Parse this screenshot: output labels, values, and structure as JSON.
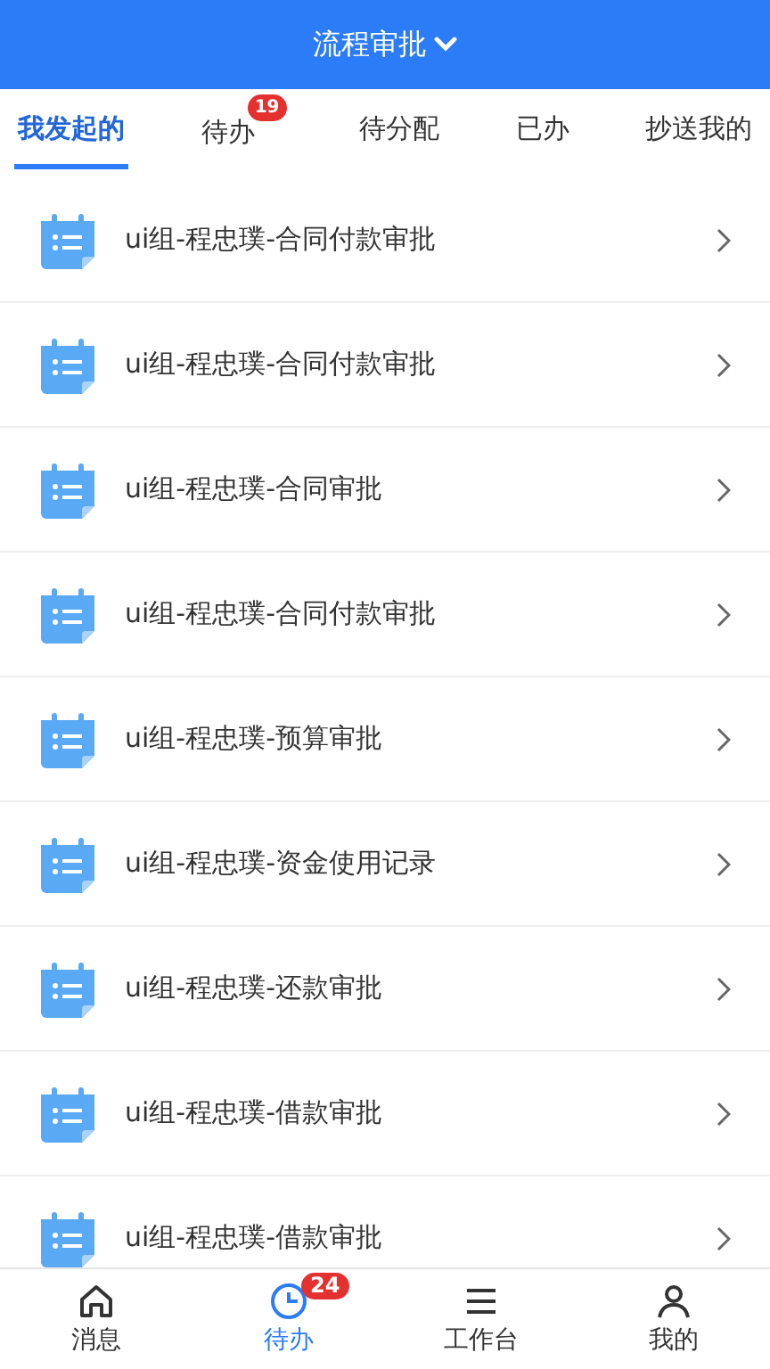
{
  "header": {
    "title": "流程审批"
  },
  "tabs": [
    {
      "label": "我发起的",
      "selected": true
    },
    {
      "label": "待办",
      "selected": false,
      "badge": "19"
    },
    {
      "label": "待分配",
      "selected": false
    },
    {
      "label": "已办",
      "selected": false
    },
    {
      "label": "抄送我的",
      "selected": false
    }
  ],
  "items": [
    {
      "title": "ui组-程忠璞-合同付款审批"
    },
    {
      "title": "ui组-程忠璞-合同付款审批"
    },
    {
      "title": "ui组-程忠璞-合同审批"
    },
    {
      "title": "ui组-程忠璞-合同付款审批"
    },
    {
      "title": "ui组-程忠璞-预算审批"
    },
    {
      "title": "ui组-程忠璞-资金使用记录"
    },
    {
      "title": "ui组-程忠璞-还款审批"
    },
    {
      "title": "ui组-程忠璞-借款审批"
    },
    {
      "title": "ui组-程忠璞-借款审批"
    }
  ],
  "bottom_nav": [
    {
      "label": "消息",
      "kind": "home",
      "selected": false
    },
    {
      "label": "待办",
      "kind": "clock",
      "selected": true,
      "badge": "24"
    },
    {
      "label": "工作台",
      "kind": "list",
      "selected": false
    },
    {
      "label": "我的",
      "kind": "person",
      "selected": false
    }
  ]
}
